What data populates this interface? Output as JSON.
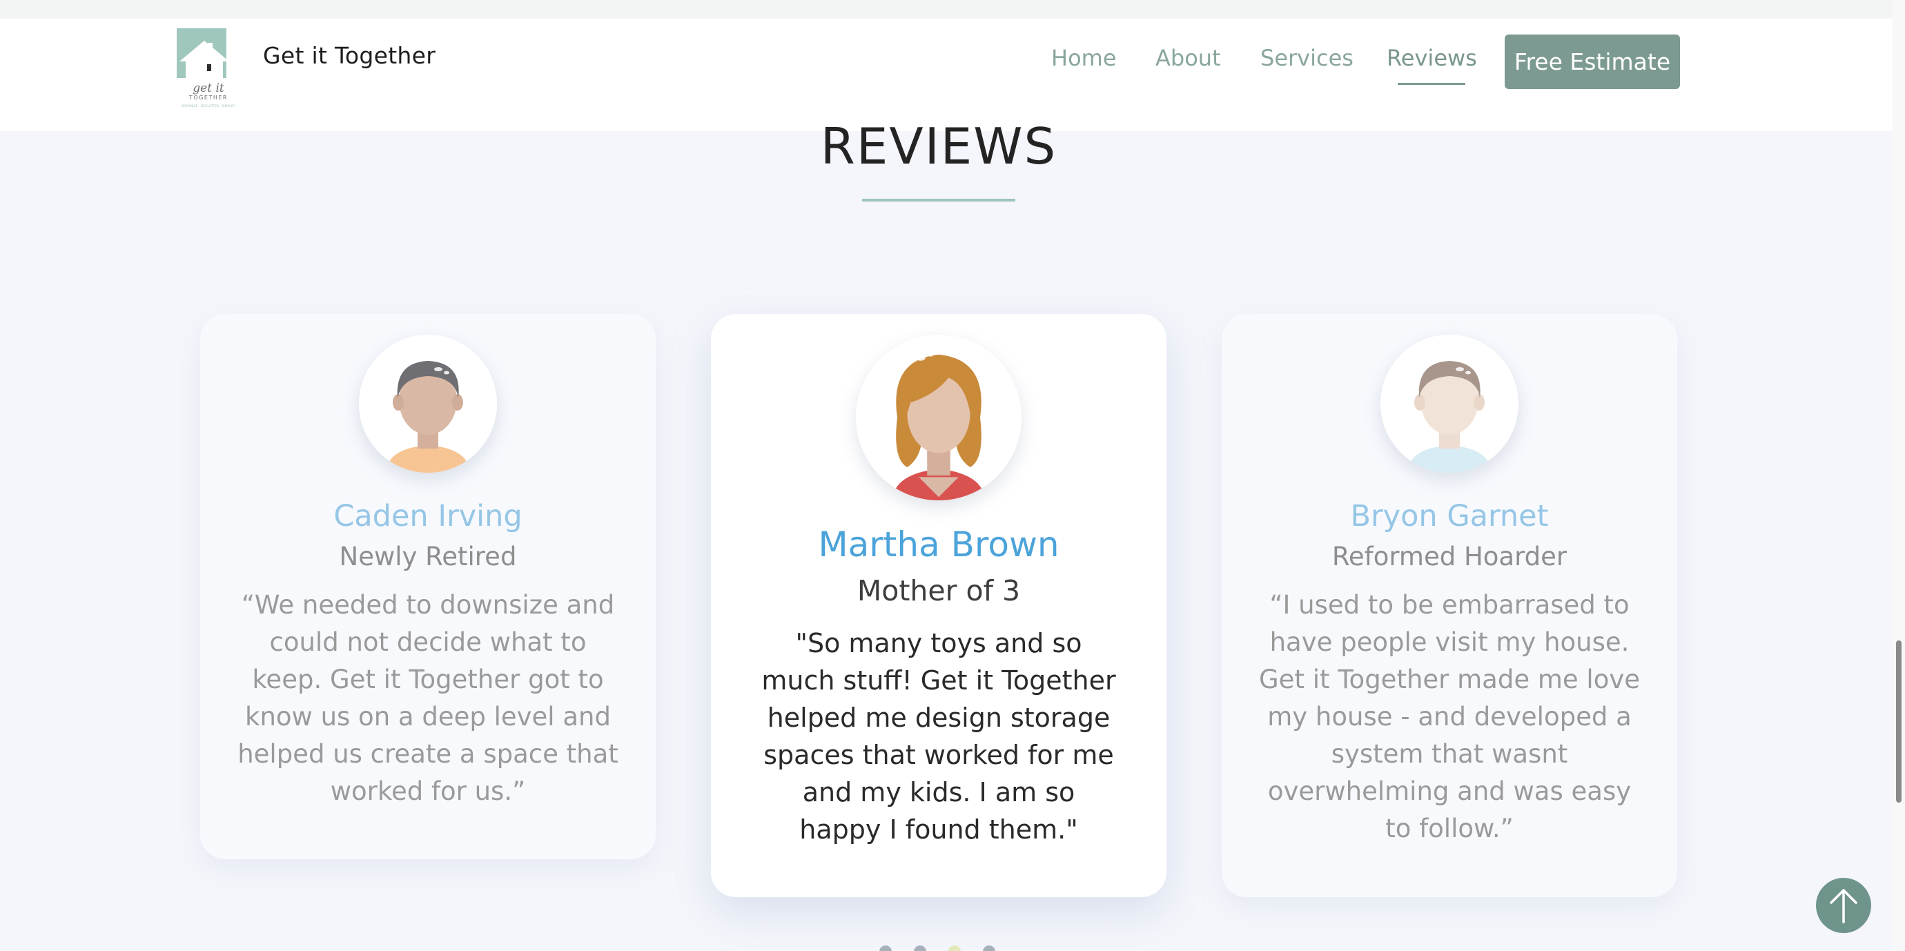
{
  "header": {
    "brand": "Get it Together",
    "nav": [
      {
        "label": "Home"
      },
      {
        "label": "About"
      },
      {
        "label": "Services"
      },
      {
        "label": "Reviews",
        "active": true
      }
    ],
    "cta_label": "Free Estimate"
  },
  "logo": {
    "text": "get it TOGETHER",
    "tagline": "ORGANIZE · DECLUTTER · SIMPLIFY"
  },
  "section": {
    "title": "REVIEWS"
  },
  "reviews": [
    {
      "name": "Caden Irving",
      "role": "Newly Retired",
      "quote": "“We needed to downsize and could not decide what to keep. Get it Together got to know us on a deep level and helped us create a space that worked for us.”",
      "avatar": "male-avatar-icon"
    },
    {
      "name": "Martha Brown",
      "role": "Mother of 3",
      "quote": "\"So many toys and so much stuff! Get it Together helped me design storage spaces that worked for me and my kids. I am so happy I found them.\"",
      "avatar": "female-avatar-icon"
    },
    {
      "name": "Bryon Garnet",
      "role": "Reformed Hoarder",
      "quote": "“I used to be embarrased to have people visit my house. Get it Together made me love my house - and developed a system that wasnt overwhelming and was easy to follow.”",
      "avatar": "male-avatar-icon"
    }
  ],
  "carousel": {
    "slide_count": 4,
    "active_index": 2
  },
  "colors": {
    "accent": "#7c9a91",
    "name_highlight": "#4ba3da",
    "name_muted": "#95c6e6",
    "underline": "#9fc4c0"
  },
  "icons": {
    "back_to_top": "arrow-up-icon"
  }
}
